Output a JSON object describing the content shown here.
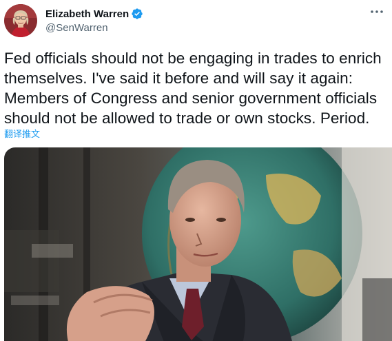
{
  "author": {
    "display_name": "Elizabeth Warren",
    "handle": "@SenWarren",
    "verified": true,
    "avatar_icon": "profile-photo",
    "verified_icon": "verified-badge-icon"
  },
  "tweet": {
    "text": "Fed officials should not be engaging in trades to enrich themselves. I've said it before and will say it again: Members of Congress and senior government officials should not be allowed to trade or own stocks. Period.",
    "translate_label": "翻译推文",
    "more_icon": "more-options-icon"
  },
  "media": {
    "type": "photo",
    "icon": "photo-media"
  },
  "colors": {
    "link": "#1d9bf0",
    "handle": "#536471",
    "text": "#0f1419",
    "verified": "#1d9bf0"
  }
}
